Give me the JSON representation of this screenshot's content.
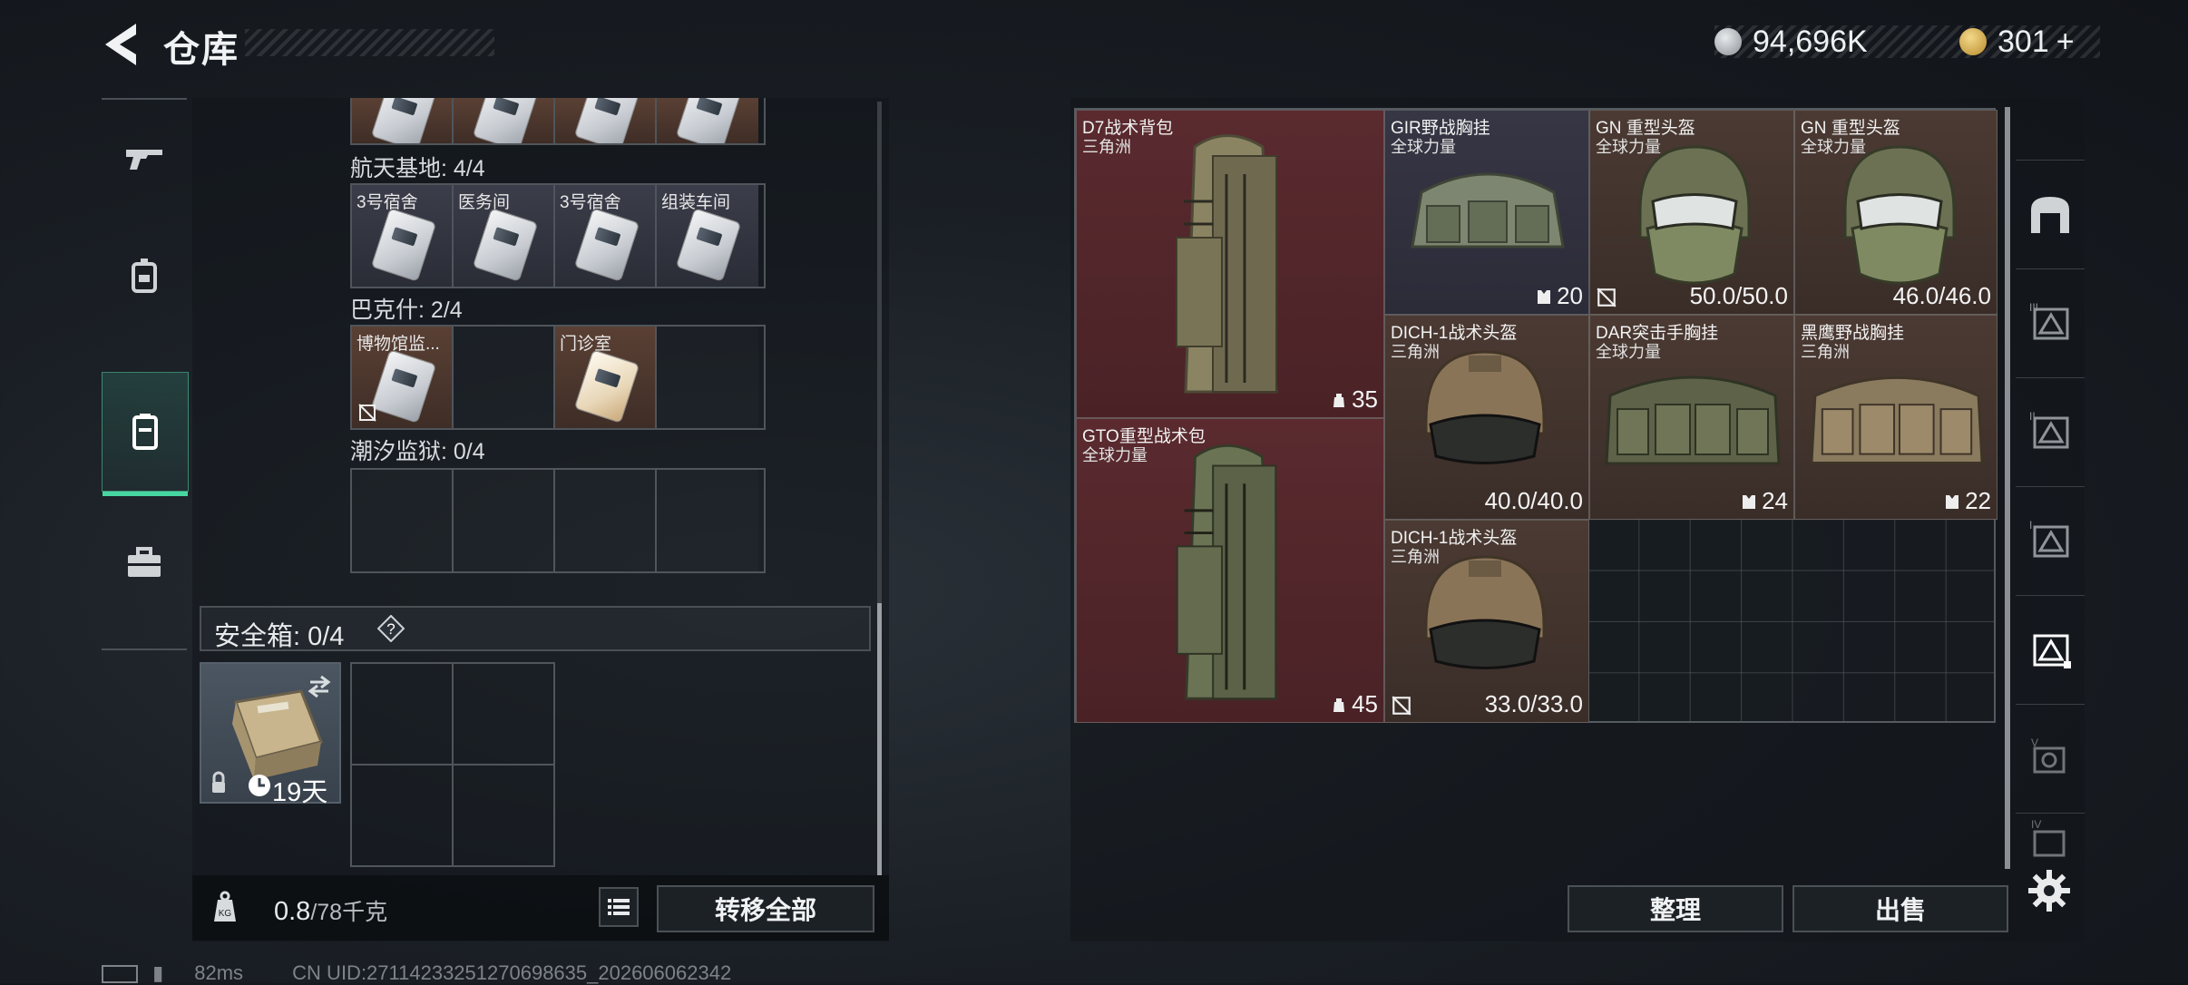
{
  "header": {
    "title": "仓库"
  },
  "currency": {
    "coins": "94,696K",
    "tokens": "301",
    "tokens_add": "+"
  },
  "left_nav": [
    "gun-icon",
    "backpack-icon",
    "keycard-case-icon",
    "toolbox-icon"
  ],
  "keycard_sections": [
    {
      "label": "航天基地: 4/4",
      "slots": [
        "3号宿舍",
        "医务间",
        "3号宿舍",
        "组装车间"
      ]
    },
    {
      "label": "巴克什: 2/4",
      "slots": [
        "博物馆监...",
        "",
        "门诊室",
        ""
      ]
    },
    {
      "label": "潮汐监狱: 0/4",
      "slots": [
        "",
        "",
        "",
        ""
      ]
    }
  ],
  "safe_box": {
    "label": "安全箱: 0/4",
    "help": "?",
    "days": "19天"
  },
  "weight": {
    "current": "0.8",
    "max": "/78千克"
  },
  "buttons": {
    "transfer_all": "转移全部",
    "organize": "整理",
    "sell": "出售"
  },
  "stash_items": [
    {
      "name": "D7战术背包",
      "sub": "三角洲",
      "value": "35"
    },
    {
      "name": "GIR野战胸挂",
      "sub": "全球力量",
      "value": "20"
    },
    {
      "name": "GN 重型头盔",
      "sub": "全球力量",
      "value": "50.0/50.0"
    },
    {
      "name": "GN 重型头盔",
      "sub": "全球力量",
      "value": "46.0/46.0"
    },
    {
      "name": "DICH-1战术头盔",
      "sub": "三角洲",
      "value": "40.0/40.0"
    },
    {
      "name": "DAR突击手胸挂",
      "sub": "全球力量",
      "value": "24"
    },
    {
      "name": "黑鹰野战胸挂",
      "sub": "三角洲",
      "value": "22"
    },
    {
      "name": "GTO重型战术包",
      "sub": "全球力量",
      "value": "45"
    },
    {
      "name": "DICH-1战术头盔",
      "sub": "三角洲",
      "value": "33.0/33.0"
    }
  ],
  "status": {
    "ping": "82ms",
    "uid": "CN UID:27114233251270698635_202606062342"
  },
  "colors": {
    "accent": "#46d7a0",
    "red_rarity": "#5a2a2f",
    "purple_rarity": "#373645",
    "brown_rarity": "#4b3a33"
  }
}
